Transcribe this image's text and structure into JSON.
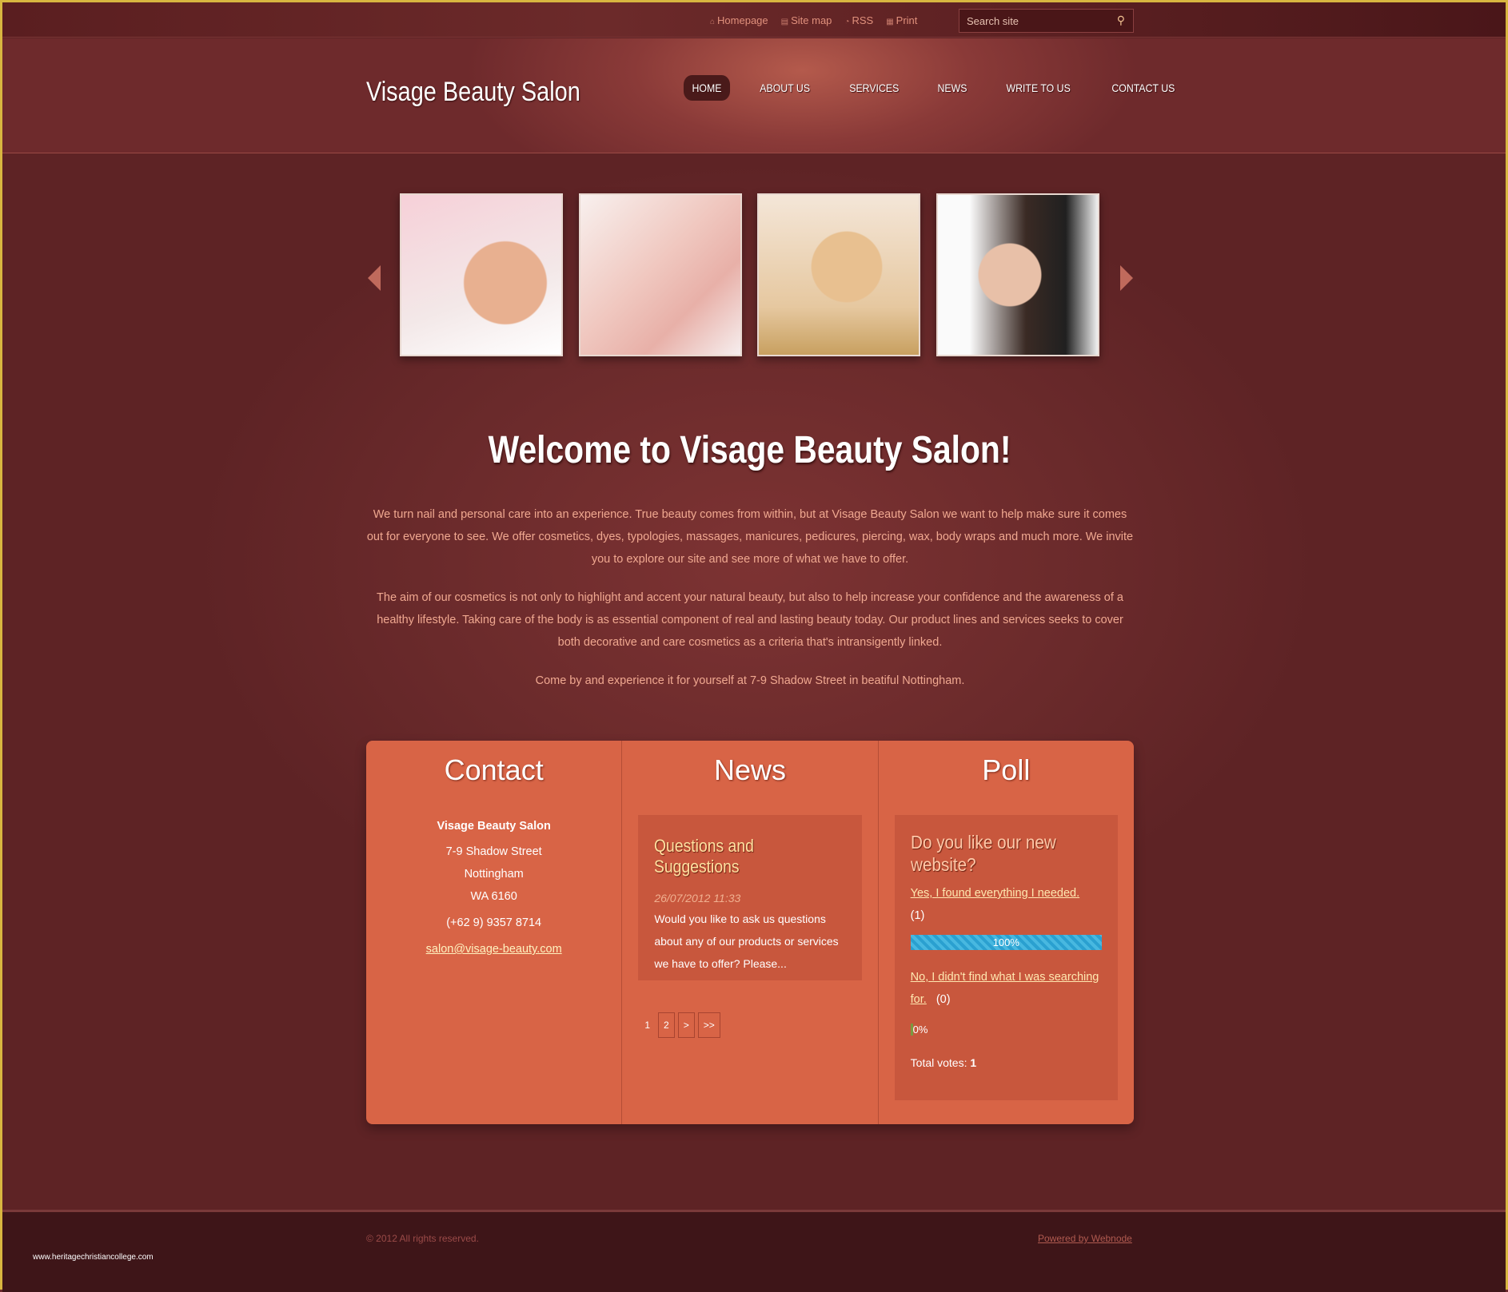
{
  "topbar": {
    "links": [
      {
        "label": "Homepage",
        "icon": "home-icon"
      },
      {
        "label": "Site map",
        "icon": "sitemap-icon"
      },
      {
        "label": "RSS",
        "icon": "rss-icon"
      },
      {
        "label": "Print",
        "icon": "print-icon"
      }
    ],
    "search_placeholder": "Search site"
  },
  "header": {
    "logo": "Visage Beauty Salon",
    "nav": [
      "HOME",
      "ABOUT US",
      "SERVICES",
      "NEWS",
      "WRITE TO US",
      "CONTACT US"
    ],
    "active": "HOME"
  },
  "main": {
    "title": "Welcome to Visage Beauty Salon!",
    "paragraphs": [
      "We turn nail and personal care into an experience. True beauty comes from within, but at Visage Beauty Salon we want to help make sure it comes out for everyone to see. We offer cosmetics, dyes, typologies, massages, manicures, pedicures, piercing, wax, body wraps and much more. We invite you to explore our site and see more of what we have to offer.",
      "The aim of our cosmetics is not only to highlight and accent your natural beauty, but also to help increase your confidence and the awareness of a healthy lifestyle. Taking care of the body is as essential component of real and lasting beauty today. Our product lines and services seeks to cover both decorative and care cosmetics as a criteria that's intransigently linked.",
      "Come by and experience it for yourself at 7-9 Shadow Street in beatiful Nottingham."
    ]
  },
  "contact": {
    "title": "Contact",
    "name": "Visage Beauty Salon",
    "street": "7-9 Shadow Street",
    "city": "Nottingham",
    "postcode": "WA 6160",
    "phone": "(+62 9) 9357 8714",
    "email": "salon@visage-beauty.com"
  },
  "news": {
    "title": "News",
    "item": {
      "title": "Questions and Suggestions",
      "date": "26/07/2012 11:33",
      "body": "Would you like to ask us questions about any of our products or services we have to offer? Please..."
    },
    "pager": [
      "1",
      "2",
      ">",
      ">>"
    ]
  },
  "poll": {
    "title": "Poll",
    "question": "Do you like our new website?",
    "options": [
      {
        "label": "Yes, I found everything I needed.",
        "count": "(1)",
        "percent": "100%",
        "value": 100
      },
      {
        "label": "No, I didn't find what I was searching for.",
        "count": "(0)",
        "percent": "0%",
        "value": 0
      }
    ],
    "total_label": "Total votes:",
    "total": "1",
    "bar_color": "#2aa0d0"
  },
  "footer": {
    "copyright": "© 2012 All rights reserved.",
    "powered": "Powered by Webnode",
    "watermark": "www.heritagechristiancollege.com"
  }
}
